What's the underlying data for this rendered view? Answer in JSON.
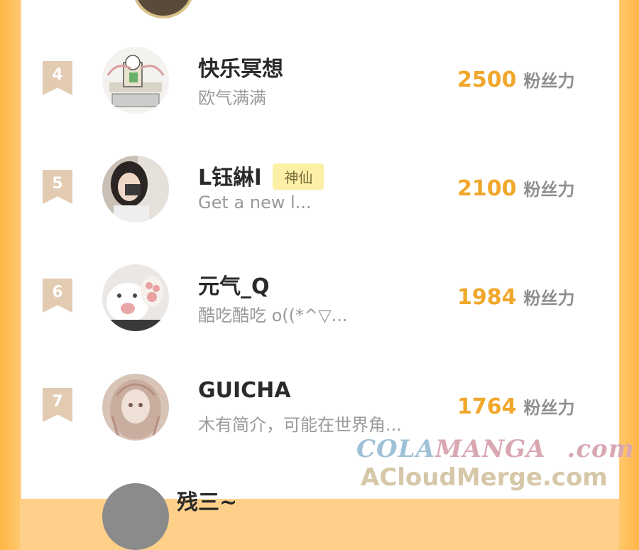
{
  "rows": [
    {
      "rank": "4",
      "name": "快乐冥想",
      "badge": "",
      "desc": "欧气满满",
      "score": "2500",
      "unit": "粉丝力"
    },
    {
      "rank": "5",
      "name": "L钰綝l",
      "badge": "神仙",
      "desc": "Get a new l...",
      "score": "2100",
      "unit": "粉丝力"
    },
    {
      "rank": "6",
      "name": "元气_Q",
      "badge": "",
      "desc": "酷吃酷吃 o((*^▽...",
      "score": "1984",
      "unit": "粉丝力"
    },
    {
      "rank": "7",
      "name": "GUICHA",
      "badge": "",
      "desc": "木有简介，可能在世界角...",
      "score": "1764",
      "unit": "粉丝力"
    }
  ],
  "partial_row": {
    "name": "残三~"
  },
  "watermark": {
    "line1_a": "COLA",
    "line1_b": "MANGA",
    "line1_c": ".com",
    "line2": "ACloudMerge.com"
  },
  "colors": {
    "accent": "#f1a72b",
    "rank_badge": "#e3cbb1",
    "frame": "#ffb648"
  }
}
